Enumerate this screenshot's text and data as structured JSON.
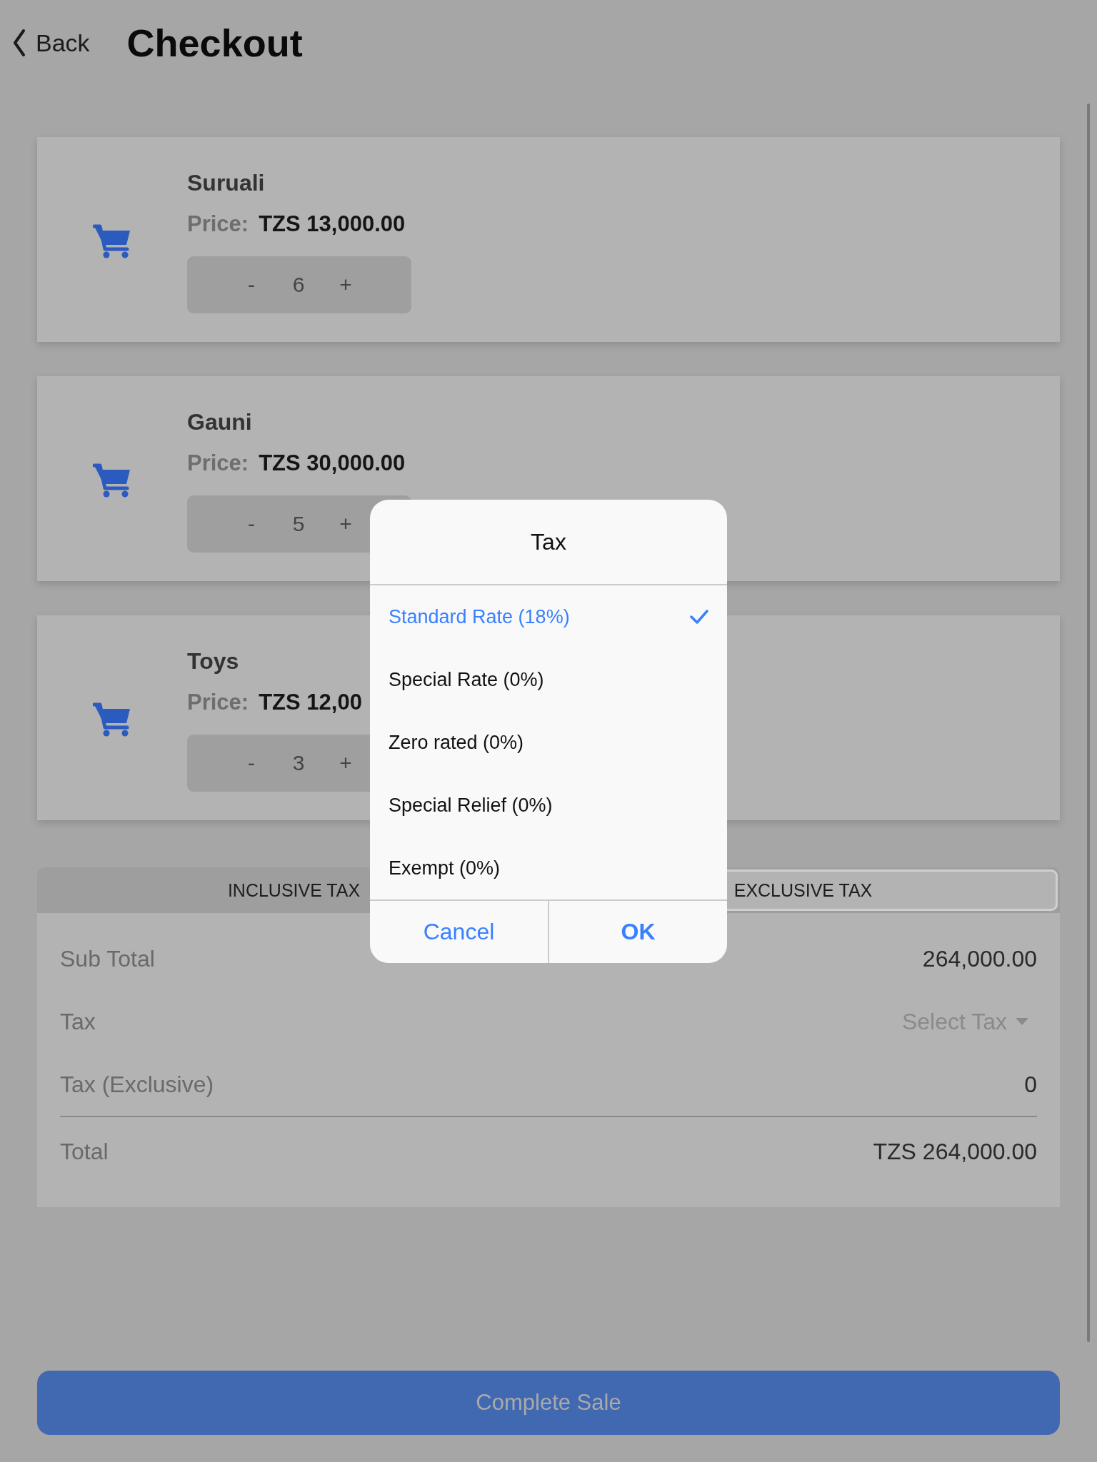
{
  "header": {
    "back_label": "Back",
    "title": "Checkout"
  },
  "cart_items": [
    {
      "name": "Suruali",
      "price_label": "Price:",
      "price": "TZS 13,000.00",
      "decrement": "-",
      "quantity": "6",
      "increment": "+"
    },
    {
      "name": "Gauni",
      "price_label": "Price:",
      "price": "TZS 30,000.00",
      "decrement": "-",
      "quantity": "5",
      "increment": "+"
    },
    {
      "name": "Toys",
      "price_label": "Price:",
      "price": "TZS 12,00",
      "decrement": "-",
      "quantity": "3",
      "increment": "+"
    }
  ],
  "tax_mode_tabs": [
    {
      "label": "INCLUSIVE TAX",
      "selected": false
    },
    {
      "label": "EXCLUSIVE TAX",
      "selected": true
    }
  ],
  "summary": [
    {
      "kind": "text",
      "label": "Sub Total",
      "value": "264,000.00"
    },
    {
      "kind": "select",
      "label": "Tax",
      "placeholder": "Select Tax"
    },
    {
      "kind": "text",
      "label": "Tax (Exclusive)",
      "value": "0"
    },
    {
      "kind": "total",
      "label": "Total",
      "value": "TZS 264,000.00"
    }
  ],
  "complete_button": "Complete Sale",
  "tax_dialog": {
    "title": "Tax",
    "options": [
      {
        "label": "Standard Rate (18%)",
        "selected": true
      },
      {
        "label": "Special Rate (0%)",
        "selected": false
      },
      {
        "label": "Zero rated (0%)",
        "selected": false
      },
      {
        "label": "Special Relief (0%)",
        "selected": false
      },
      {
        "label": "Exempt (0%)",
        "selected": false
      }
    ],
    "buttons": [
      {
        "kind": "cancel",
        "label": "Cancel"
      },
      {
        "kind": "confirm",
        "label": "OK"
      }
    ]
  }
}
